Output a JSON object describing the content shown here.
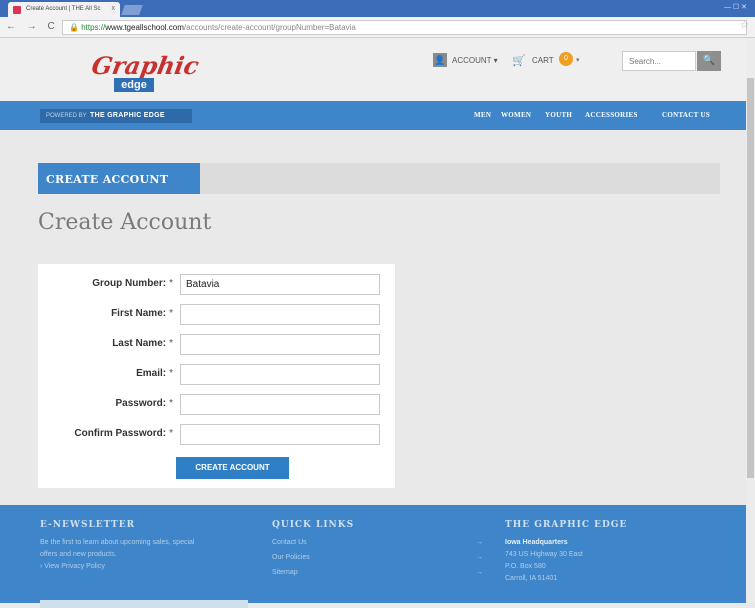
{
  "browser": {
    "tab_title": "Create Account | THE All Sc",
    "tab_close": "x",
    "window_controls": "— ☐ ✕",
    "nav_glyphs": "← → C",
    "url_lock": "🔒",
    "url_scheme": "https://",
    "url_host": "www.tgeallschool.com",
    "url_path": "/accounts/create-account/groupNumber=Batavia",
    "star": "☆"
  },
  "header": {
    "logo_script": "Graphic",
    "logo_edge": "edge",
    "account_icon": "👤",
    "account_label": "ACCOUNT ▾",
    "cart_icon": "🛒",
    "cart_label": "CART",
    "cart_count": "0",
    "cart_caret": "▾",
    "search_placeholder": "Search...",
    "search_btn": "🔍"
  },
  "nav": {
    "powered_by": "POWERED BY",
    "brand": "THE GRAPHIC EDGE",
    "items": [
      "MEN",
      "WOMEN",
      "YOUTH",
      "ACCESSORIES",
      "CONTACT US"
    ]
  },
  "banner": {
    "label": "CREATE ACCOUNT"
  },
  "page": {
    "title": "Create Account"
  },
  "form": {
    "required_mark": "*",
    "fields": [
      {
        "label": "Group Number:",
        "value": "Batavia"
      },
      {
        "label": "First Name:",
        "value": ""
      },
      {
        "label": "Last Name:",
        "value": ""
      },
      {
        "label": "Email:",
        "value": ""
      },
      {
        "label": "Password:",
        "value": ""
      },
      {
        "label": "Confirm Password:",
        "value": ""
      }
    ],
    "submit_label": "CREATE ACCOUNT"
  },
  "footer": {
    "newsletter": {
      "heading": "E-NEWSLETTER",
      "line1": "Be the first to learn about upcoming sales, special",
      "line2": "offers and new products.",
      "link": "› View Privacy Policy"
    },
    "quick_links": {
      "heading": "QUICK LINKS",
      "items": [
        "Contact Us",
        "Our Policies",
        "Sitemap"
      ],
      "arrow": "→"
    },
    "company": {
      "heading": "THE GRAPHIC EDGE",
      "hq": "Iowa Headquarters",
      "addr1": "743 US Highway 30 East",
      "addr2": "P.O. Box 580",
      "addr3": "Carroll, IA 51401"
    }
  },
  "colors": {
    "brand_blue": "#3e86c9",
    "logo_red": "#c8312f",
    "cart_badge": "#f0a020"
  }
}
